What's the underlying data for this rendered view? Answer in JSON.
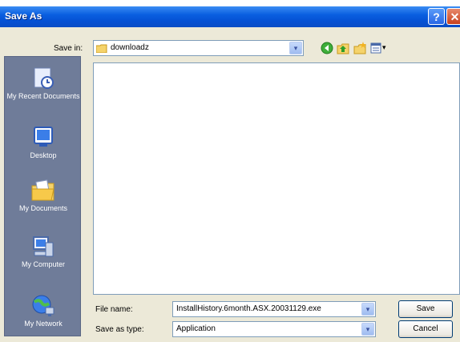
{
  "window": {
    "title": "Save As",
    "help_glyph": "?",
    "close_glyph": "✕"
  },
  "top": {
    "save_in_label": "Save in:",
    "save_in_value": "downloadz",
    "dropdown_glyph": "▾"
  },
  "toolbar": {
    "icons": [
      "back-icon",
      "up-folder-icon",
      "new-folder-icon",
      "views-menu-icon"
    ],
    "views_glyph": "▾"
  },
  "sidebar": {
    "items": [
      {
        "label": "My Recent Documents",
        "icon": "recent-documents-icon"
      },
      {
        "label": "Desktop",
        "icon": "desktop-icon"
      },
      {
        "label": "My Documents",
        "icon": "my-documents-icon"
      },
      {
        "label": "My Computer",
        "icon": "my-computer-icon"
      },
      {
        "label": "My Network",
        "icon": "my-network-icon"
      }
    ]
  },
  "form": {
    "file_name_label": "File name:",
    "file_name_value": "InstallHistory.6month.ASX.20031129.exe",
    "save_as_type_label": "Save as type:",
    "save_as_type_value": "Application",
    "save_label": "Save",
    "cancel_label": "Cancel"
  }
}
